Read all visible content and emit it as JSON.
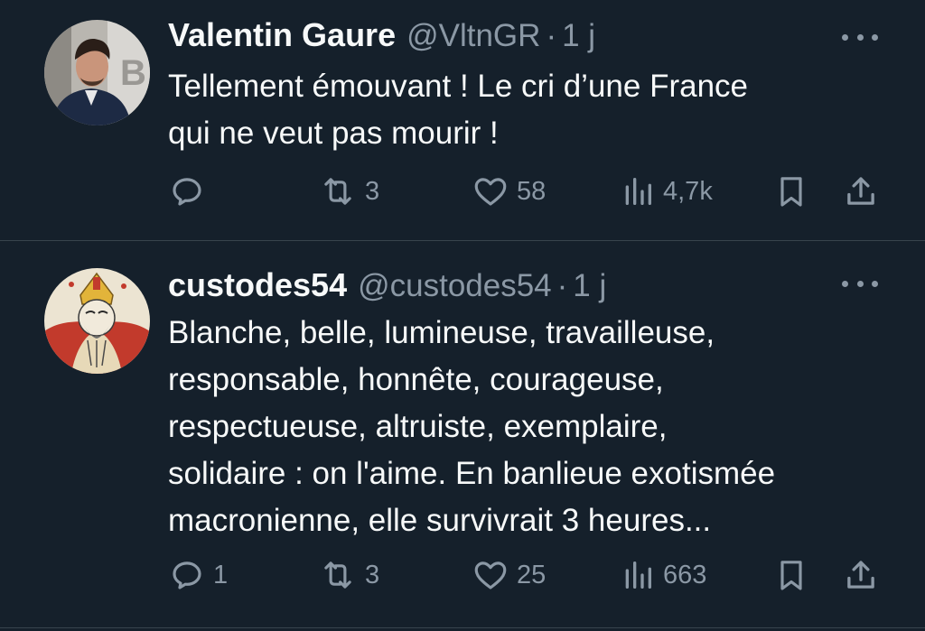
{
  "tweets": [
    {
      "display_name": "Valentin Gaure",
      "handle": "@VltnGR",
      "separator": "·",
      "time": "1 j",
      "text": "Tellement émouvant ! Le cri d’une France\nqui ne veut pas mourir !",
      "replies": "",
      "retweets": "3",
      "likes": "58",
      "views": "4,7k",
      "avatar_icon": "person-photo-avatar"
    },
    {
      "display_name": "custodes54",
      "handle": "@custodes54",
      "separator": "·",
      "time": "1 j",
      "text": "Blanche, belle, lumineuse, travailleuse,\nresponsable, honnête, courageuse,\nrespectueuse, altruiste, exemplaire,\nsolidaire : on l'aime. En banlieue exotismée\nmacronienne, elle survivrait 3 heures...",
      "replies": "1",
      "retweets": "3",
      "likes": "25",
      "views": "663",
      "avatar_icon": "bishop-illustration-avatar"
    }
  ],
  "colors": {
    "background": "#15202b",
    "text": "#f7f9f9",
    "secondary": "#8b98a5",
    "divider": "#38444d"
  },
  "icons": [
    "reply-icon",
    "retweet-icon",
    "like-icon",
    "views-icon",
    "bookmark-icon",
    "share-icon",
    "more-options-icon"
  ]
}
